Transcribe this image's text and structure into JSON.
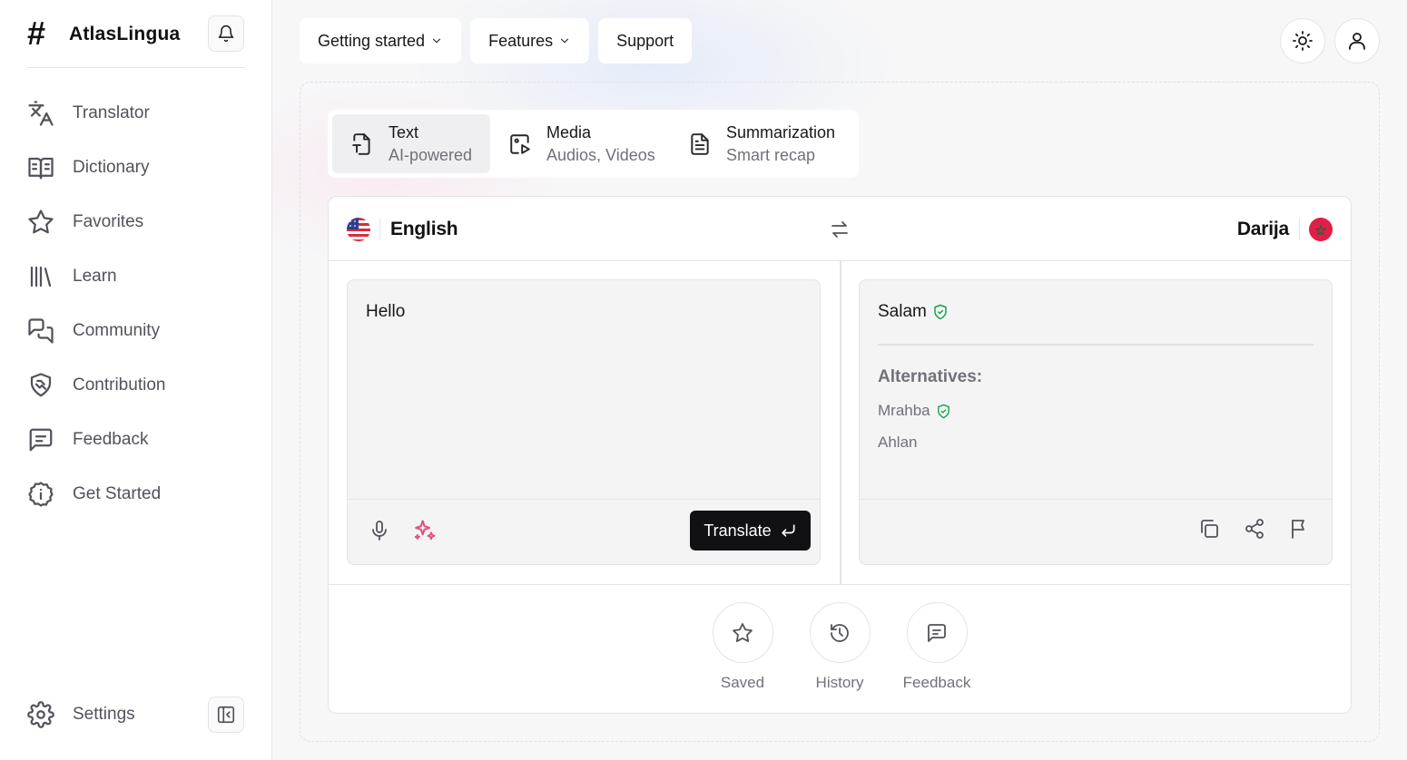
{
  "app": {
    "name": "AtlasLingua"
  },
  "sidebar": {
    "items": [
      {
        "label": "Translator",
        "icon": "translate-icon"
      },
      {
        "label": "Dictionary",
        "icon": "book-icon"
      },
      {
        "label": "Favorites",
        "icon": "star-icon"
      },
      {
        "label": "Learn",
        "icon": "library-icon"
      },
      {
        "label": "Community",
        "icon": "chat-bubbles-icon"
      },
      {
        "label": "Contribution",
        "icon": "handshake-icon"
      },
      {
        "label": "Feedback",
        "icon": "message-square-icon"
      },
      {
        "label": "Get Started",
        "icon": "info-badge-icon"
      }
    ],
    "settings_label": "Settings"
  },
  "topnav": {
    "items": [
      {
        "label": "Getting started",
        "has_dropdown": true
      },
      {
        "label": "Features",
        "has_dropdown": true
      },
      {
        "label": "Support",
        "has_dropdown": false
      }
    ]
  },
  "modes": [
    {
      "title": "Text",
      "subtitle": "AI-powered",
      "icon": "text-file-icon",
      "active": true
    },
    {
      "title": "Media",
      "subtitle": "Audios, Videos",
      "icon": "media-file-icon",
      "active": false
    },
    {
      "title": "Summarization",
      "subtitle": "Smart recap",
      "icon": "document-icon",
      "active": false
    }
  ],
  "translator": {
    "source_language": "English",
    "target_language": "Darija",
    "source_text": "Hello",
    "translate_label": "Translate",
    "result": "Salam",
    "alternatives_label": "Alternatives:",
    "alternatives": [
      {
        "text": "Mrahba",
        "verified": true
      },
      {
        "text": "Ahlan",
        "verified": false
      }
    ]
  },
  "bottom_actions": [
    {
      "label": "Saved",
      "icon": "star-icon"
    },
    {
      "label": "History",
      "icon": "history-icon"
    },
    {
      "label": "Feedback",
      "icon": "message-square-icon"
    }
  ],
  "colors": {
    "accent_dark": "#111114",
    "verified_green": "#16a34a",
    "sparkle_pink": "#e0527e",
    "morocco_red": "#e11d48"
  }
}
